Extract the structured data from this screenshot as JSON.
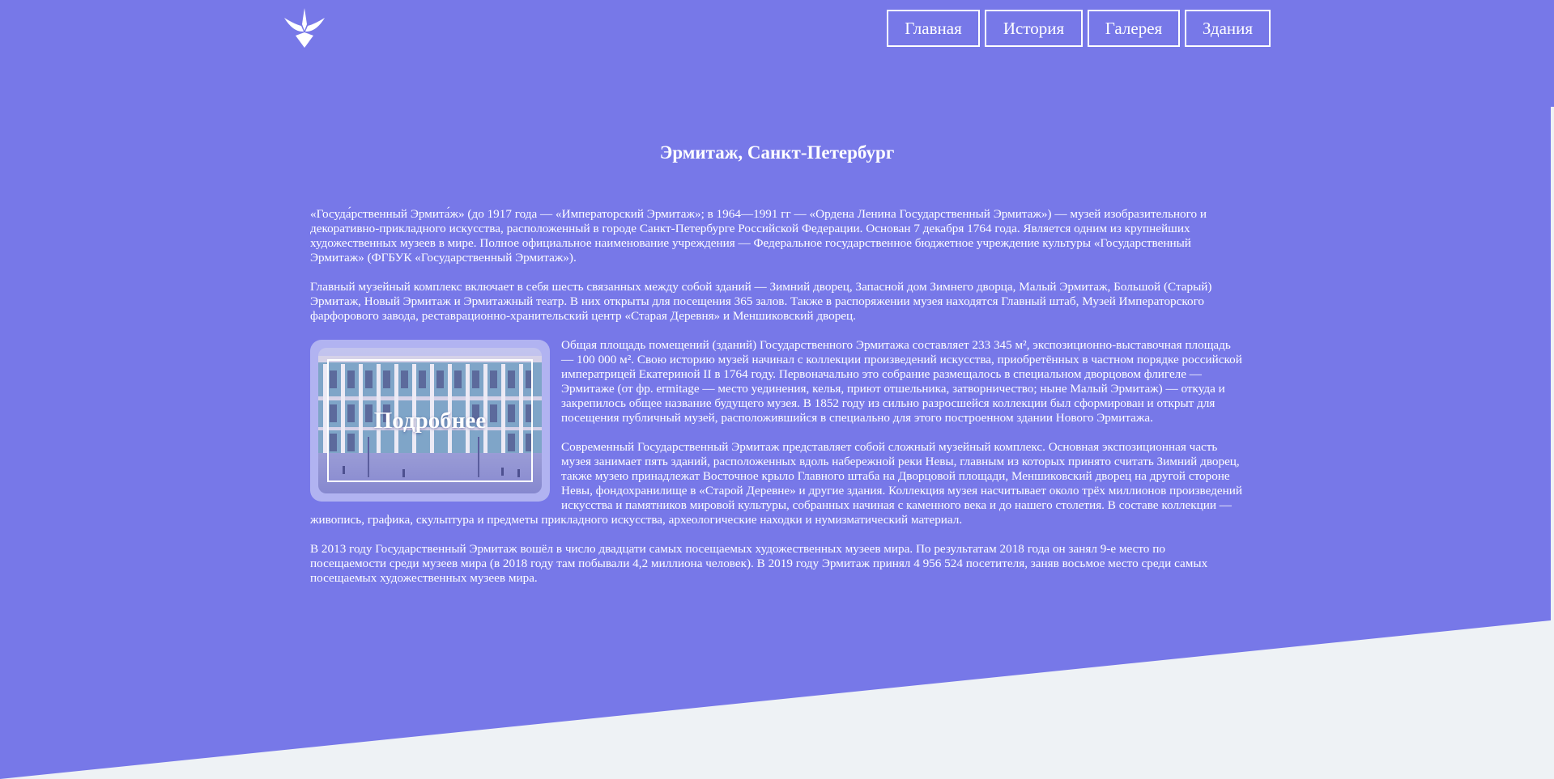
{
  "colors": {
    "primary": "#7778e8",
    "background": "#eef2f5",
    "card": "#b1b3f1",
    "text": "#ffffff"
  },
  "header": {
    "logo_icon": "stylized-bird-logo",
    "nav": [
      {
        "label": "Главная"
      },
      {
        "label": "История"
      },
      {
        "label": "Галерея"
      },
      {
        "label": "Здания"
      }
    ]
  },
  "page": {
    "title": "Эрмитаж, Санкт-Петербург",
    "paragraphs": [
      "«Госуда́рственный Эрмита́ж» (до 1917 года — «Императорский Эрмитаж»; в 1964—1991 гг — «Ордена Ленина Государственный Эрмитаж») — музей изобразительного и декоративно-прикладного искусства, расположенный в городе Санкт-Петербурге Российской Федерации. Основан 7 декабря 1764 года. Является одним из крупнейших художественных музеев в мире. Полное официальное наименование учреждения — Федеральное государственное бюджетное учреждение культуры «Государственный Эрмитаж» (ФГБУК «Государственный Эрмитаж»).",
      "Главный музейный комплекс включает в себя шесть связанных между собой зданий — Зимний дворец, Запасной дом Зимнего дворца, Малый Эрмитаж, Большой (Старый) Эрмитаж, Новый Эрмитаж и Эрмитажный театр. В них открыты для посещения 365 залов. Также в распоряжении музея находятся Главный штаб, Музей Императорского фарфорового завода, реставрационно-хранительский центр «Старая Деревня» и Меншиковский дворец.",
      "Общая площадь помещений (зданий) Государственного Эрмитажа составляет 233 345 м², экспозиционно-выставочная площадь — 100 000 м². Свою историю музей начинал с коллекции произведений искусства, приобретённых в частном порядке российской императрицей Екатериной II в 1764 году. Первоначально это собрание размещалось в специальном дворцовом флигеле — Эрмитаже (от фр. ermitage — место уединения, келья, приют отшельника, затворничество; ныне Малый Эрмитаж) — откуда и закрепилось общее название будущего музея. В 1852 году из сильно разросшейся коллекции был сформирован и открыт для посещения публичный музей, расположившийся в специально для этого построенном здании Нового Эрмитажа.",
      "Современный Государственный Эрмитаж представляет собой сложный музейный комплекс. Основная экспозиционная часть музея занимает пять зданий, расположенных вдоль набережной реки Невы, главным из которых принято считать Зимний дворец, также музею принадлежат Восточное крыло Главного штаба на Дворцовой площади, Меншиковский дворец на другой стороне Невы, фондохранилище в «Старой Деревне» и другие здания. Коллекция музея насчитывает около трёх миллионов произведений искусства и памятников мировой культуры, собранных начиная с каменного века и до нашего столетия. В составе коллекции — живопись, графика, скульптура и предметы прикладного искусства, археологические находки и нумизматический материал.",
      "В 2013 году Государственный Эрмитаж вошёл в число двадцати самых посещаемых художественных музеев мира. По результатам 2018 года он занял 9-е место по посещаемости среди музеев мира (в 2018 году там побывали 4,2 миллиона человек). В 2019 году Эрмитаж принял 4 956 524 посетителя, заняв восьмое место среди самых посещаемых художественных музеев мира."
    ],
    "card": {
      "label": "Подробнее",
      "image": "winter-palace-photo"
    }
  }
}
